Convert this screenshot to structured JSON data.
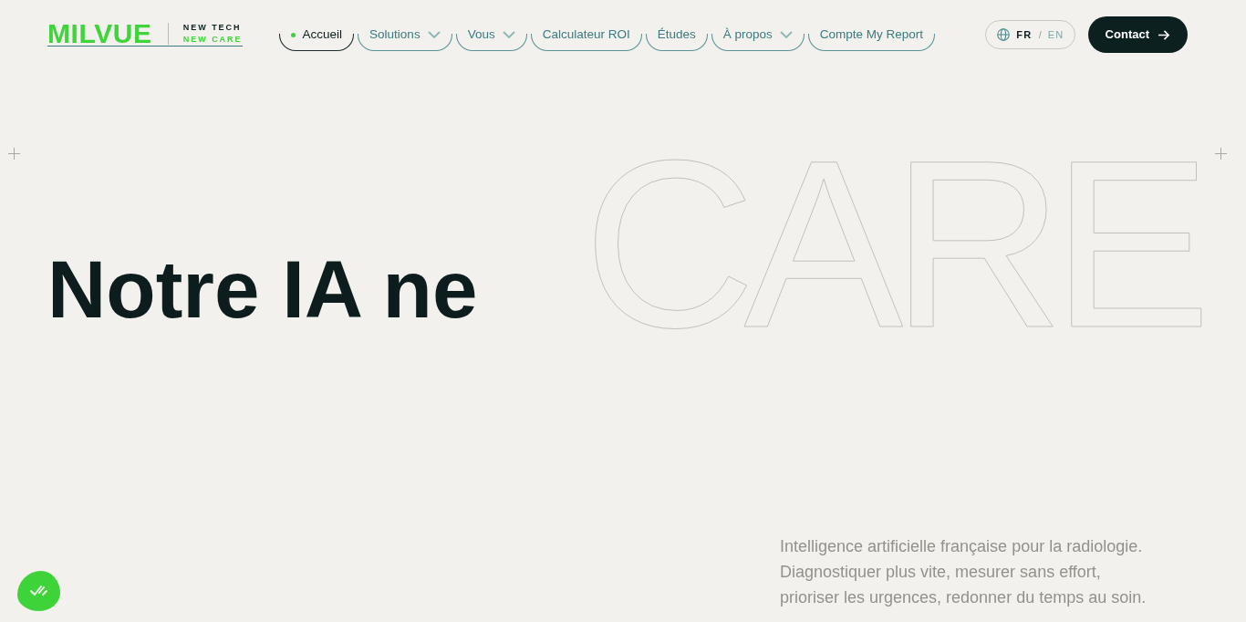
{
  "header": {
    "logo": {
      "wordmark": "MILVUE",
      "tagline_top": "NEW TECH",
      "tagline_bottom": "NEW CARE"
    },
    "nav": [
      {
        "label": "Accueil",
        "selected": true,
        "has_menu": false
      },
      {
        "label": "Solutions",
        "selected": false,
        "has_menu": true
      },
      {
        "label": "Vous",
        "selected": false,
        "has_menu": true
      },
      {
        "label": "Calculateur ROI",
        "selected": false,
        "has_menu": false
      },
      {
        "label": "Études",
        "selected": false,
        "has_menu": false
      },
      {
        "label": "À propos",
        "selected": false,
        "has_menu": true
      },
      {
        "label": "Compte My Report",
        "selected": false,
        "has_menu": false
      }
    ],
    "language_switcher": {
      "languages": [
        {
          "label": "FR",
          "selected": true
        },
        {
          "label": "EN",
          "selected": false
        }
      ],
      "separator": "/"
    },
    "contact_button": {
      "label": "Contact"
    }
  },
  "hero": {
    "headline": "Notre IA ne",
    "outline_word": "CARE",
    "description": "Intelligence artificielle française pour la radiologie.\nDiagnostiquer plus vite, mesurer sans effort,\nprioriser les urgences, redonner du temps au soin."
  }
}
